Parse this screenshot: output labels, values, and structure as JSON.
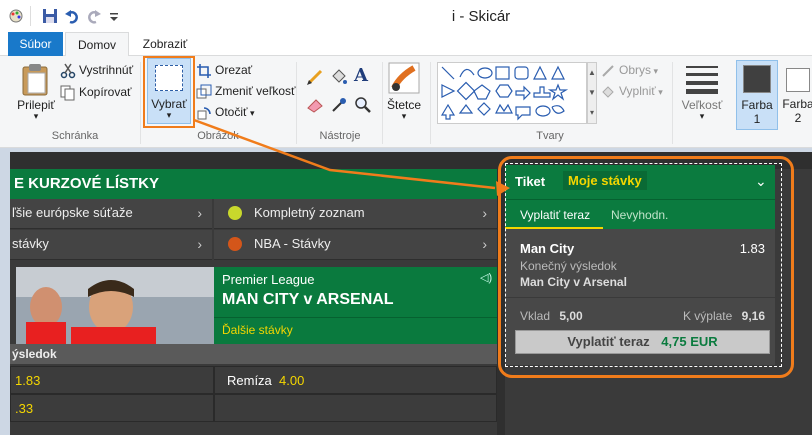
{
  "window": {
    "title": "i - Skicár"
  },
  "tabs": {
    "file": "Súbor",
    "home": "Domov",
    "view": "Zobraziť"
  },
  "ribbon": {
    "paste": "Prilepiť",
    "cut": "Vystrihnúť",
    "copy": "Kopírovať",
    "clipboard_group": "Schránka",
    "select": "Vybrať",
    "crop": "Orezať",
    "resize": "Zmeniť veľkosť",
    "rotate": "Otočiť",
    "image_group": "Obrázok",
    "tools_group": "Nástroje",
    "brushes": "Štetce",
    "shapes_group": "Tvary",
    "outline": "Obrys",
    "fill": "Vyplniť",
    "size": "Veľkosť",
    "color1": "Farba",
    "color1_num": "1",
    "color2": "Farba",
    "color2_num": "2"
  },
  "betting": {
    "header": "E KURZOVÉ LÍSTKY",
    "row1_left": "ľšie európske súťaže",
    "row1_right": "Kompletný zoznam",
    "row2_left": "stávky",
    "row2_right": "NBA - Stávky",
    "league": "Premier League",
    "match": "MAN CITY v ARSENAL",
    "more_bets": "Ďalšie stávky",
    "result_bar": "ýsledok",
    "odd1": "1.83",
    "draw_label": "Remíza",
    "draw_odd": "4.00",
    "odd2": ".33"
  },
  "ticket": {
    "tab_ticket": "Tiket",
    "tab_my_bets": "Moje stávky",
    "cashout_tab": "Vyplatiť teraz",
    "unsettled_tab": "Nevyhodn.",
    "selection": "Man City",
    "selection_odd": "1.83",
    "market": "Konečný výsledok",
    "event": "Man City v Arsenal",
    "stake_label": "Vklad",
    "stake_value": "5,00",
    "payout_label": "K výplate",
    "payout_value": "9,16",
    "cashout_button": "Vyplatiť teraz",
    "cashout_amount": "4,75 EUR"
  },
  "colors": {
    "accent_orange": "#f07c1b",
    "green": "#0b7b3f",
    "yellow": "#f4d600",
    "file_tab": "#1979ca"
  }
}
